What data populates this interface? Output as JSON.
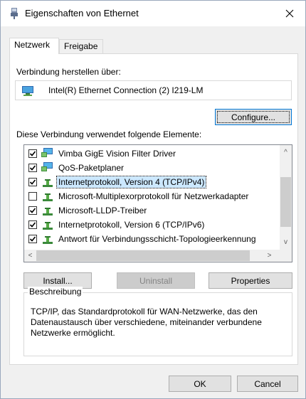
{
  "window": {
    "title": "Eigenschaften von Ethernet",
    "close_glyph": "✕"
  },
  "tabs": [
    {
      "label": "Netzwerk",
      "active": true
    },
    {
      "label": "Freigabe",
      "active": false
    }
  ],
  "connect_using": {
    "label": "Verbindung herstellen über:",
    "adapter_name": "Intel(R) Ethernet Connection (2) I219-LM",
    "adapter_icon": "network-adapter-icon",
    "configure_label": "Configure..."
  },
  "components": {
    "label": "Diese Verbindung verwendet folgende Elemente:",
    "items": [
      {
        "label": "Vimba GigE Vision Filter Driver",
        "checked": true,
        "icon": "network-service-icon"
      },
      {
        "label": "QoS-Paketplaner",
        "checked": true,
        "icon": "network-service-icon"
      },
      {
        "label": "Internetprotokoll, Version 4 (TCP/IPv4)",
        "checked": true,
        "icon": "protocol-icon",
        "selected": true
      },
      {
        "label": "Microsoft-Multiplexorprotokoll für Netzwerkadapter",
        "checked": false,
        "icon": "protocol-icon"
      },
      {
        "label": "Microsoft-LLDP-Treiber",
        "checked": true,
        "icon": "protocol-icon"
      },
      {
        "label": "Internetprotokoll, Version 6 (TCP/IPv6)",
        "checked": true,
        "icon": "protocol-icon"
      },
      {
        "label": "Antwort für Verbindungsschicht-Topologieerkennung",
        "checked": true,
        "icon": "protocol-icon"
      }
    ]
  },
  "buttons": {
    "install": "Install...",
    "uninstall": "Uninstall",
    "properties": "Properties",
    "ok": "OK",
    "cancel": "Cancel"
  },
  "description": {
    "title": "Beschreibung",
    "text": "TCP/IP, das Standardprotokoll für WAN-Netzwerke, das den Datenaustausch über verschiedene, miteinander verbundene Netzwerke ermöglicht."
  },
  "colors": {
    "selection": "#cce8ff",
    "focus_border": "#0078d7",
    "dialog_bg": "#f0f0f0"
  }
}
